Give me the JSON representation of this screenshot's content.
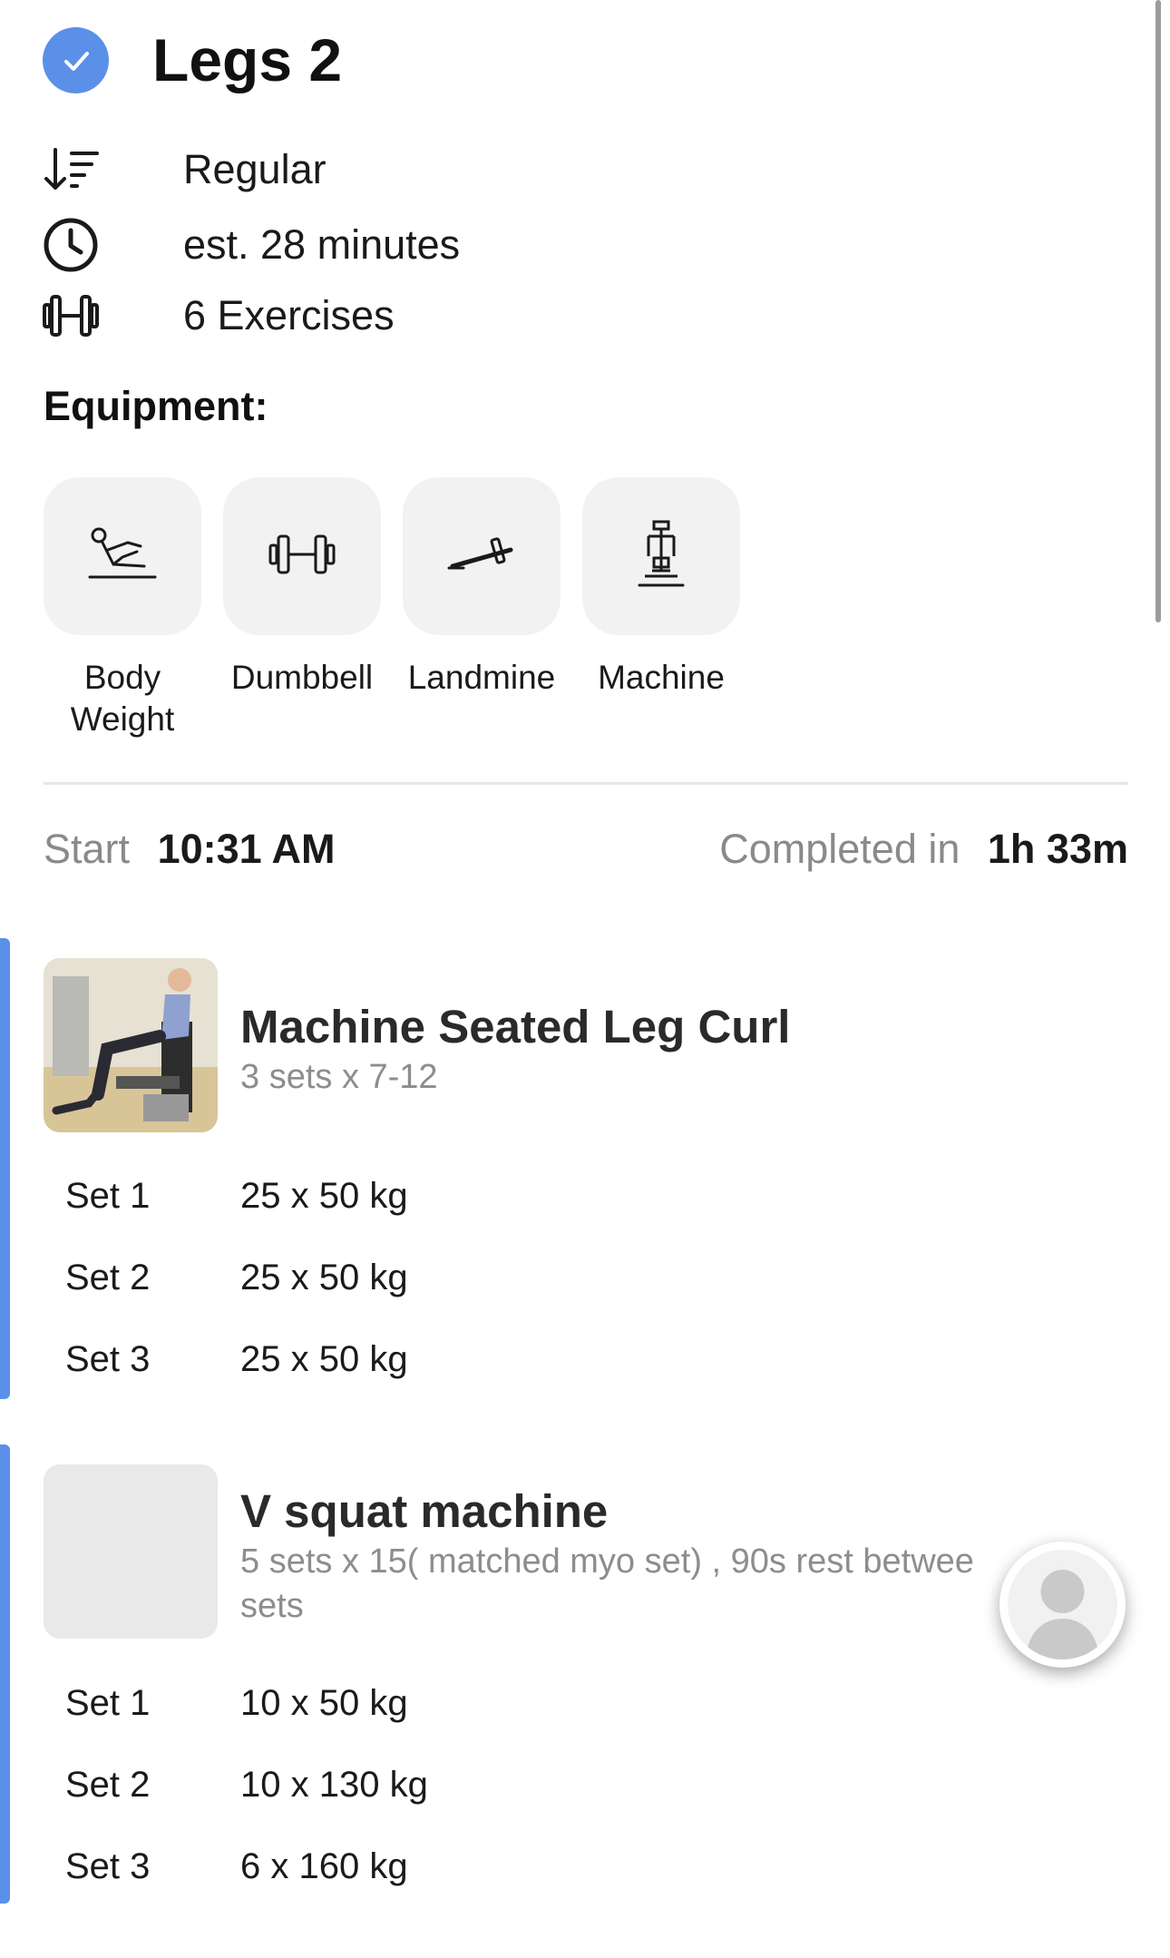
{
  "workout": {
    "title": "Legs 2",
    "type": "Regular",
    "duration": "est. 28 minutes",
    "exercise_count": "6 Exercises"
  },
  "equipment": {
    "heading": "Equipment:",
    "items": [
      {
        "label": "Body Weight",
        "icon": "body-weight-icon"
      },
      {
        "label": "Dumbbell",
        "icon": "dumbbell-icon"
      },
      {
        "label": "Landmine",
        "icon": "landmine-icon"
      },
      {
        "label": "Machine",
        "icon": "machine-icon"
      }
    ]
  },
  "session": {
    "start_label": "Start",
    "start_time": "10:31 AM",
    "completed_label": "Completed in",
    "completed_time": "1h 33m"
  },
  "exercises": [
    {
      "name": "Machine Seated Leg Curl",
      "scheme": "3 sets x 7-12",
      "sets": [
        {
          "label": "Set 1",
          "value": "25 x 50 kg"
        },
        {
          "label": "Set 2",
          "value": "25 x 50 kg"
        },
        {
          "label": "Set 3",
          "value": "25 x 50 kg"
        }
      ]
    },
    {
      "name": "V squat machine",
      "scheme_line1": "5 sets x 15( matched myo set) , 90s rest betwee",
      "scheme_line2": "sets",
      "sets": [
        {
          "label": "Set 1",
          "value": "10 x 50 kg"
        },
        {
          "label": "Set 2",
          "value": "10 x 130 kg"
        },
        {
          "label": "Set 3",
          "value": "6 x 160 kg"
        }
      ]
    }
  ],
  "colors": {
    "accent": "#5b90e8",
    "tile_bg": "#f2f2f2",
    "muted_text": "#8a8a8a"
  }
}
